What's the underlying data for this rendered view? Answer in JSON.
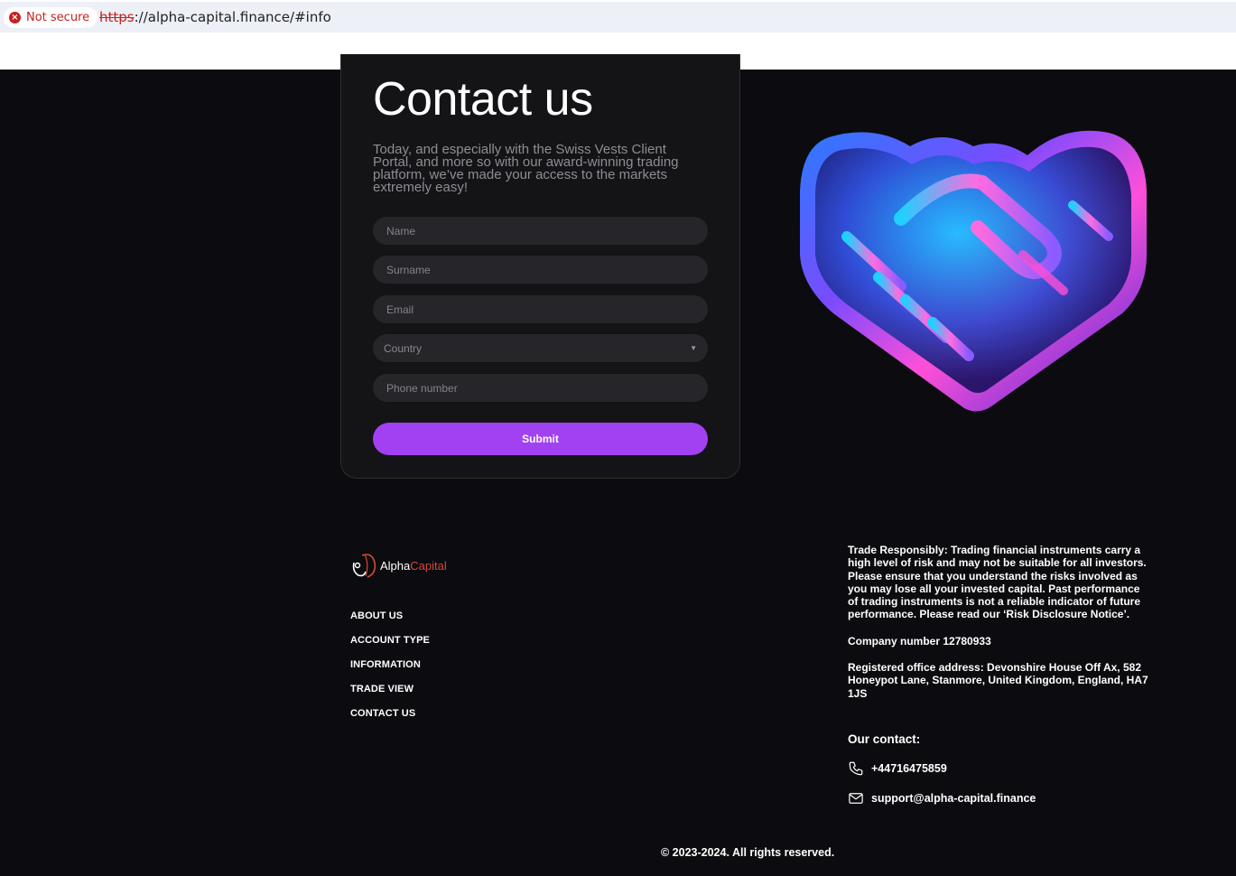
{
  "browser": {
    "security_label": "Not secure",
    "url_scheme": "https",
    "url_rest": "://alpha-capital.finance/#info",
    "security_color": "#c5221f"
  },
  "contact_form": {
    "title": "Contact us",
    "description": "Today, and especially with the Swiss Vests Client Portal, and more so with our award-winning trading platform, we’ve made your access to the markets extremely easy!",
    "fields": {
      "name_placeholder": "Name",
      "surname_placeholder": "Surname",
      "email_placeholder": "Email",
      "country_selected": "Country",
      "phone_placeholder": "Phone number"
    },
    "submit_label": "Submit",
    "accent_color": "#a241f2"
  },
  "footer": {
    "logo": {
      "alpha": "Alpha",
      "capital": "Capital"
    },
    "nav": [
      "ABOUT US",
      "ACCOUNT TYPE",
      "INFORMATION",
      "TRADE VIEW",
      "CONTACT US"
    ],
    "legal": {
      "risk": "Trade Responsibly: Trading financial instruments carry a high level of risk and may not be suitable for all investors. Please ensure that you understand the risks involved as you may lose all your invested capital. Past performance of trading instruments is not a reliable indicator of future performance. Please read our ‘Risk Disclosure Notice’.",
      "company": "Company number 12780933",
      "address": "Registered office address: Devonshire House Off Ax, 582 Honeypot Lane, Stanmore, United Kingdom, England, HA7 1JS"
    },
    "contact_heading": "Our contact:",
    "phone": "+44716475859",
    "email": "support@alpha-capital.finance",
    "copyright": "© 2023-2024. All rights reserved.",
    "icons": {
      "phone": "phone-icon",
      "email": "mail-icon"
    }
  }
}
